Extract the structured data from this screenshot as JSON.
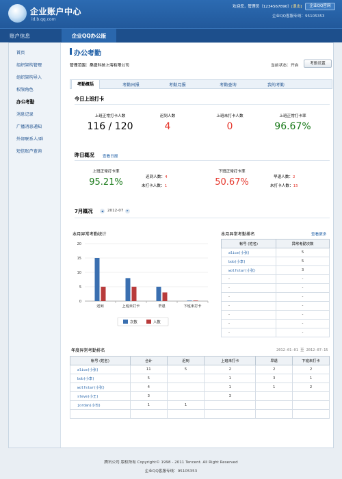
{
  "header": {
    "brand": "企业账户中心",
    "domain": "id.b.qq.com",
    "welcome_prefix": "欢迎您，管理员（1234567890）",
    "logout": "[退出]",
    "qq_site_button": "企业QQ官网",
    "hotline": "企业QQ客服专线：95105353"
  },
  "nav": [
    "账户信息",
    "企业QQ办公版"
  ],
  "sidebar": [
    {
      "label": "首页"
    },
    {
      "label": "组织架构管理"
    },
    {
      "label": "组织架构导入"
    },
    {
      "label": "权限角色"
    },
    {
      "label": "办公考勤",
      "active": true
    },
    {
      "label": "消息记录"
    },
    {
      "label": "广播消息通知"
    },
    {
      "label": "外部联系人/群"
    },
    {
      "label": "短信账户查询"
    }
  ],
  "page": {
    "title": "办公考勤",
    "scope": "管理范围：桑盛科技上海有限公司",
    "state_label": "当前状态：",
    "state_value": "开启",
    "settings_button": "考勤设置"
  },
  "tabs": [
    "考勤概括",
    "考勤日报",
    "考勤月报",
    "考勤查询",
    "我的考勤"
  ],
  "today": {
    "title": "今日上班打卡",
    "stats": [
      {
        "label": "上班正常打卡人数",
        "value": "116 / 120",
        "color": "#000000"
      },
      {
        "label": "迟到人数",
        "value": "4",
        "color": "#e5352a"
      },
      {
        "label": "上班未打卡人数",
        "value": "0",
        "color": "#e5352a"
      },
      {
        "label": "上班正常打卡率",
        "value": "96.67%",
        "color": "#1a7a1a"
      }
    ]
  },
  "yesterday": {
    "title": "昨日概况",
    "link": "查看日报",
    "on_rate_label": "上班正常打卡率",
    "on_rate": "95.21%",
    "late_label": "迟到人数：",
    "late": "4",
    "miss_on_label": "未打卡人数：",
    "miss_on": "1",
    "off_rate_label": "下班正常打卡率",
    "off_rate": "50.67%",
    "early_label": "早退人数：",
    "early": "2",
    "miss_off_label": "未打卡人数：",
    "miss_off": "15"
  },
  "month": {
    "title": "7月概况",
    "prev": "◀",
    "period": "2012-07",
    "next": "▸"
  },
  "chart_data": {
    "type": "bar",
    "title": "本月异常考勤统计",
    "categories": [
      "迟到",
      "上班未打卡",
      "早退",
      "下班未打卡"
    ],
    "series": [
      {
        "name": "次数",
        "color": "#3a6fb0",
        "values": [
          15,
          8,
          5,
          0
        ]
      },
      {
        "name": "人数",
        "color": "#b83b3b",
        "values": [
          5,
          5,
          3,
          0
        ]
      }
    ],
    "yticks": [
      0,
      5,
      10,
      15,
      20
    ],
    "ylim": [
      0,
      20
    ],
    "grid": true,
    "legend": "bottom"
  },
  "ranking": {
    "title": "本月异常考勤排名",
    "more": "查看更多",
    "columns": [
      "帐号 (姓名)",
      "异常考勤次数"
    ],
    "rows": [
      [
        "alice(小张)",
        "5"
      ],
      [
        "bob(小李)",
        "5"
      ],
      [
        "wolfstar(小张)",
        "3"
      ],
      [
        "-",
        "-"
      ],
      [
        "-",
        "-"
      ],
      [
        "-",
        "-"
      ],
      [
        "-",
        "-"
      ],
      [
        "-",
        "-"
      ],
      [
        "-",
        "-"
      ],
      [
        "-",
        "-"
      ]
    ]
  },
  "yearly": {
    "title": "年度异常考勤排名",
    "range": "2012-01-01 至 2012-07-15",
    "columns": [
      "帐号 (姓名)",
      "合计",
      "迟到",
      "上班未打卡",
      "早退",
      "下班未打卡"
    ],
    "rows": [
      [
        "alice(小张)",
        "11",
        "5",
        "2",
        "2",
        "2"
      ],
      [
        "bob(小李)",
        "5",
        "",
        "1",
        "3",
        "1"
      ],
      [
        "wolfstar(小张)",
        "4",
        "",
        "1",
        "1",
        "2"
      ],
      [
        "steve(小王)",
        "3",
        "",
        "3",
        "",
        ""
      ],
      [
        "jordan(小司)",
        "1",
        "1",
        "",
        "",
        ""
      ],
      [
        "",
        "",
        "",
        "",
        "",
        ""
      ]
    ]
  },
  "footer": {
    "line1": "腾讯公司  版权所有    Copyright©  1998 - 2011 Tencent.  All Right Reserved",
    "line2": "企业QQ客服专线：95105353"
  }
}
